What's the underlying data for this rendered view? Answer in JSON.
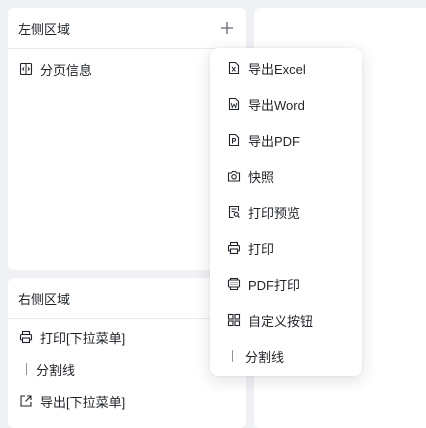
{
  "left_top": {
    "title": "左侧区域",
    "items": [
      {
        "label": "分页信息",
        "icon": "pagination-icon"
      }
    ]
  },
  "left_bottom": {
    "title": "右侧区域",
    "items": [
      {
        "label": "打印[下拉菜单]",
        "icon": "printer-icon"
      },
      {
        "label": "分割线",
        "icon": "divider-icon"
      },
      {
        "label": "导出[下拉菜单]",
        "icon": "export-icon"
      }
    ]
  },
  "menu": {
    "items": [
      {
        "label": "导出Excel",
        "icon": "excel-file-icon"
      },
      {
        "label": "导出Word",
        "icon": "word-file-icon"
      },
      {
        "label": "导出PDF",
        "icon": "pdf-file-icon"
      },
      {
        "label": "快照",
        "icon": "camera-icon"
      },
      {
        "label": "打印预览",
        "icon": "print-preview-icon"
      },
      {
        "label": "打印",
        "icon": "printer-icon"
      },
      {
        "label": "PDF打印",
        "icon": "pdf-print-icon"
      },
      {
        "label": "自定义按钮",
        "icon": "grid-icon"
      },
      {
        "label": "分割线",
        "icon": "divider-icon"
      }
    ]
  }
}
